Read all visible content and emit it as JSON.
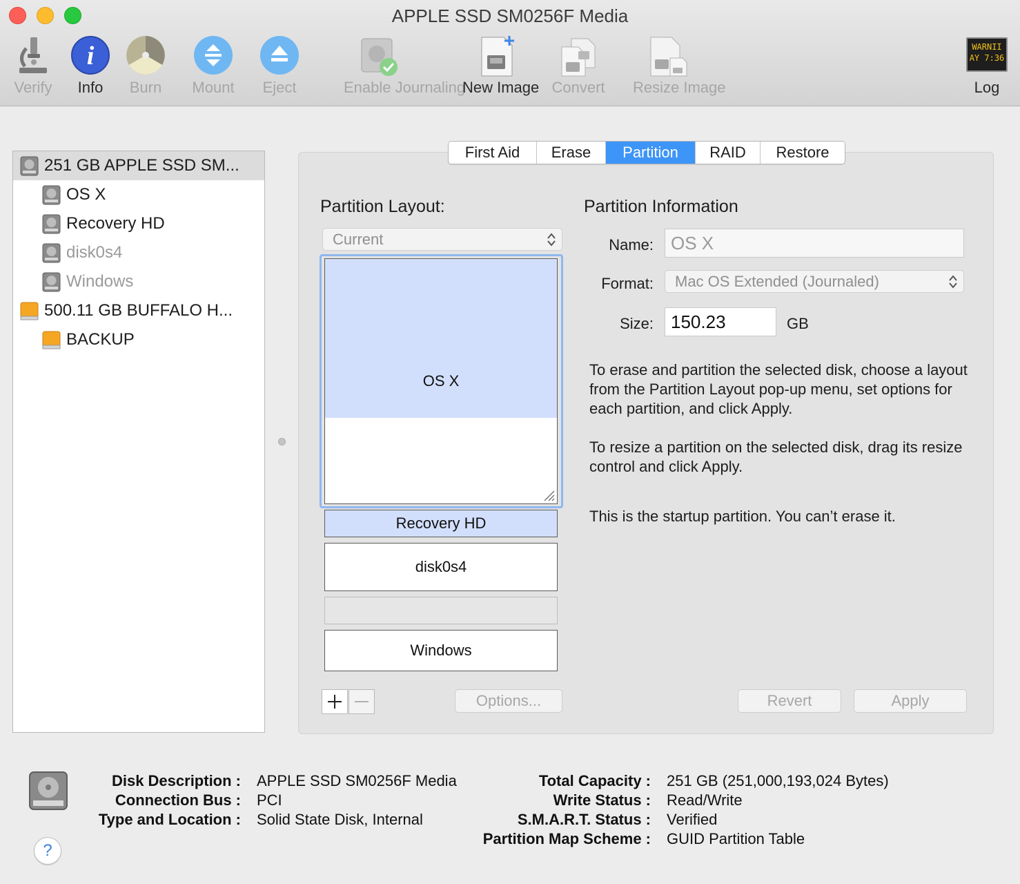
{
  "window": {
    "title": "APPLE SSD SM0256F Media"
  },
  "toolbar": {
    "verify": "Verify",
    "info": "Info",
    "burn": "Burn",
    "mount": "Mount",
    "eject": "Eject",
    "enable_journaling": "Enable Journaling",
    "new_image": "New Image",
    "convert": "Convert",
    "resize_image": "Resize Image",
    "log": "Log",
    "log_icon_text_1": "WARNII",
    "log_icon_text_2": "AY 7:36"
  },
  "sidebar": {
    "items": [
      {
        "label": "251 GB APPLE SSD SM...",
        "icon": "internal-disk-icon"
      },
      {
        "label": "OS X",
        "icon": "volume-icon"
      },
      {
        "label": "Recovery HD",
        "icon": "volume-icon"
      },
      {
        "label": "disk0s4",
        "icon": "volume-icon"
      },
      {
        "label": "Windows",
        "icon": "volume-icon"
      },
      {
        "label": "500.11 GB BUFFALO H...",
        "icon": "external-disk-icon"
      },
      {
        "label": "BACKUP",
        "icon": "external-volume-icon"
      }
    ]
  },
  "tabs": [
    "First Aid",
    "Erase",
    "Partition",
    "RAID",
    "Restore"
  ],
  "partition": {
    "layout_heading": "Partition Layout:",
    "layout_value": "Current",
    "map": {
      "osx": "OS X",
      "osx_used_fraction": 0.65,
      "recovery": "Recovery HD",
      "disk0s4": "disk0s4",
      "windows": "Windows"
    },
    "options_button": "Options...",
    "revert_button": "Revert",
    "apply_button": "Apply",
    "info_heading": "Partition Information",
    "name_label": "Name:",
    "name_value": "OS X",
    "format_label": "Format:",
    "format_value": "Mac OS Extended (Journaled)",
    "size_label": "Size:",
    "size_value": "150.23",
    "size_unit": "GB",
    "para1": "To erase and partition the selected disk, choose a layout from the Partition Layout pop-up menu, set options for each partition, and click Apply.",
    "para2": "To resize a partition on the selected disk, drag its resize control and click Apply.",
    "para3": "This is the startup partition. You can’t erase it."
  },
  "footer": {
    "disk_description_key": "Disk Description :",
    "disk_description_value": "APPLE SSD SM0256F Media",
    "connection_bus_key": "Connection Bus :",
    "connection_bus_value": "PCI",
    "type_location_key": "Type and Location :",
    "type_location_value": "Solid State Disk, Internal",
    "total_capacity_key": "Total Capacity :",
    "total_capacity_value": "251 GB (251,000,193,024 Bytes)",
    "write_status_key": "Write Status :",
    "write_status_value": "Read/Write",
    "smart_status_key": "S.M.A.R.T. Status :",
    "smart_status_value": "Verified",
    "partition_map_key": "Partition Map Scheme :",
    "partition_map_value": "GUID Partition Table",
    "help": "?"
  },
  "colors": {
    "accent": "#3d95f7",
    "partition_fill": "#d2dffc",
    "sidebar_selected": "#dcdcdc"
  }
}
